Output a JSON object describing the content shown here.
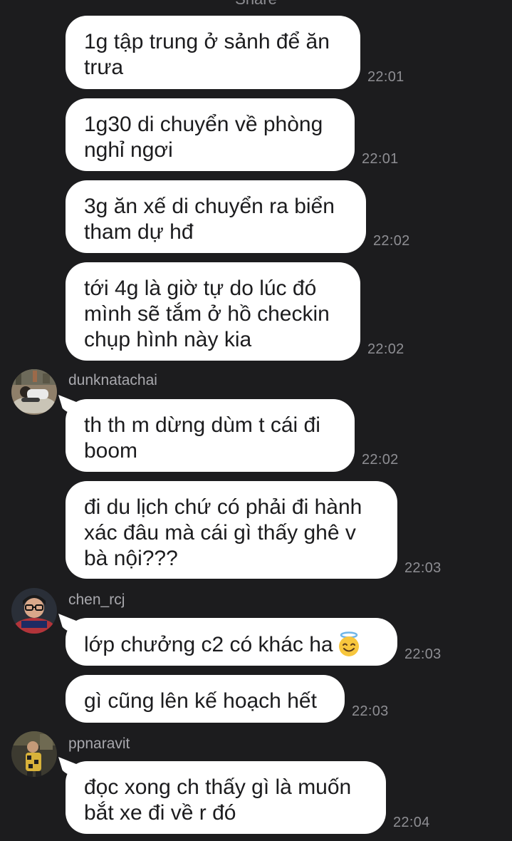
{
  "header": {
    "cut_text": "Share"
  },
  "messages": [
    {
      "text": "1g tập trung ở sảnh để ăn\ntrưa",
      "time": "22:01"
    },
    {
      "text": "1g30 di chuyển về phòng\nnghỉ ngơi",
      "time": "22:01"
    },
    {
      "text": "3g ăn xế di chuyển ra biển\ntham dự hđ",
      "time": "22:02"
    },
    {
      "text": "tới 4g là giờ tự do lúc đó\nmình sẽ tắm ở hồ checkin\nchụp hình này kia",
      "time": "22:02"
    },
    {
      "sender": "dunknatachai",
      "text": "th th m dừng dùm t cái đi\nboom",
      "time": "22:02"
    },
    {
      "text": "đi du lịch chứ có phải đi hành\nxác đâu mà cái gì thấy ghê v\nbà nội???",
      "time": "22:03"
    },
    {
      "sender": "chen_rcj",
      "text": "lớp chưởng c2 có khác ha",
      "emoji": "smiling-face-with-halo-icon",
      "time": "22:03"
    },
    {
      "text": "gì cũng lên kế hoạch hết",
      "time": "22:03"
    },
    {
      "sender": "ppnaravit",
      "text": "đọc xong ch thấy gì là muốn\nbắt xe đi về r đó",
      "time": "22:04"
    }
  ],
  "colors": {
    "background": "#1c1c1e",
    "bubble": "#ffffff",
    "text": "#1c1c1e",
    "timestamp": "#8e8e93",
    "username": "#a8a8ad"
  }
}
